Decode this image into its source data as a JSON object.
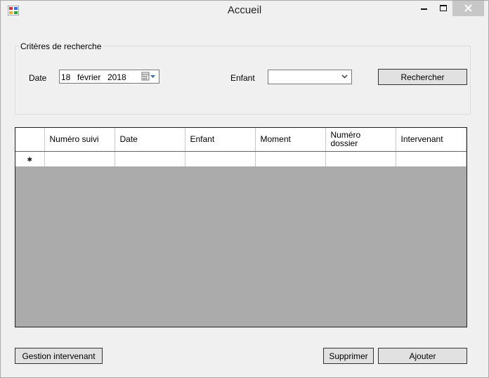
{
  "window": {
    "title": "Accueil",
    "close_color": "#c7c7c7"
  },
  "search": {
    "group_title": "Critères de recherche",
    "date_label": "Date",
    "date": {
      "day": "18",
      "month": "février",
      "year": "2018"
    },
    "child_label": "Enfant",
    "child_value": "",
    "search_button": "Rechercher"
  },
  "table": {
    "columns": [
      {
        "line1": "Numéro suivi",
        "line2": ""
      },
      {
        "line1": "Date",
        "line2": ""
      },
      {
        "line1": "Enfant",
        "line2": ""
      },
      {
        "line1": "Moment",
        "line2": ""
      },
      {
        "line1": "Numéro",
        "line2": "dossier"
      },
      {
        "line1": "Intervenant",
        "line2": ""
      }
    ],
    "new_row_marker": "✱",
    "empty_area_color": "#ababab"
  },
  "footer": {
    "manage_button": "Gestion intervenant",
    "delete_button": "Supprimer",
    "add_button": "Ajouter"
  }
}
